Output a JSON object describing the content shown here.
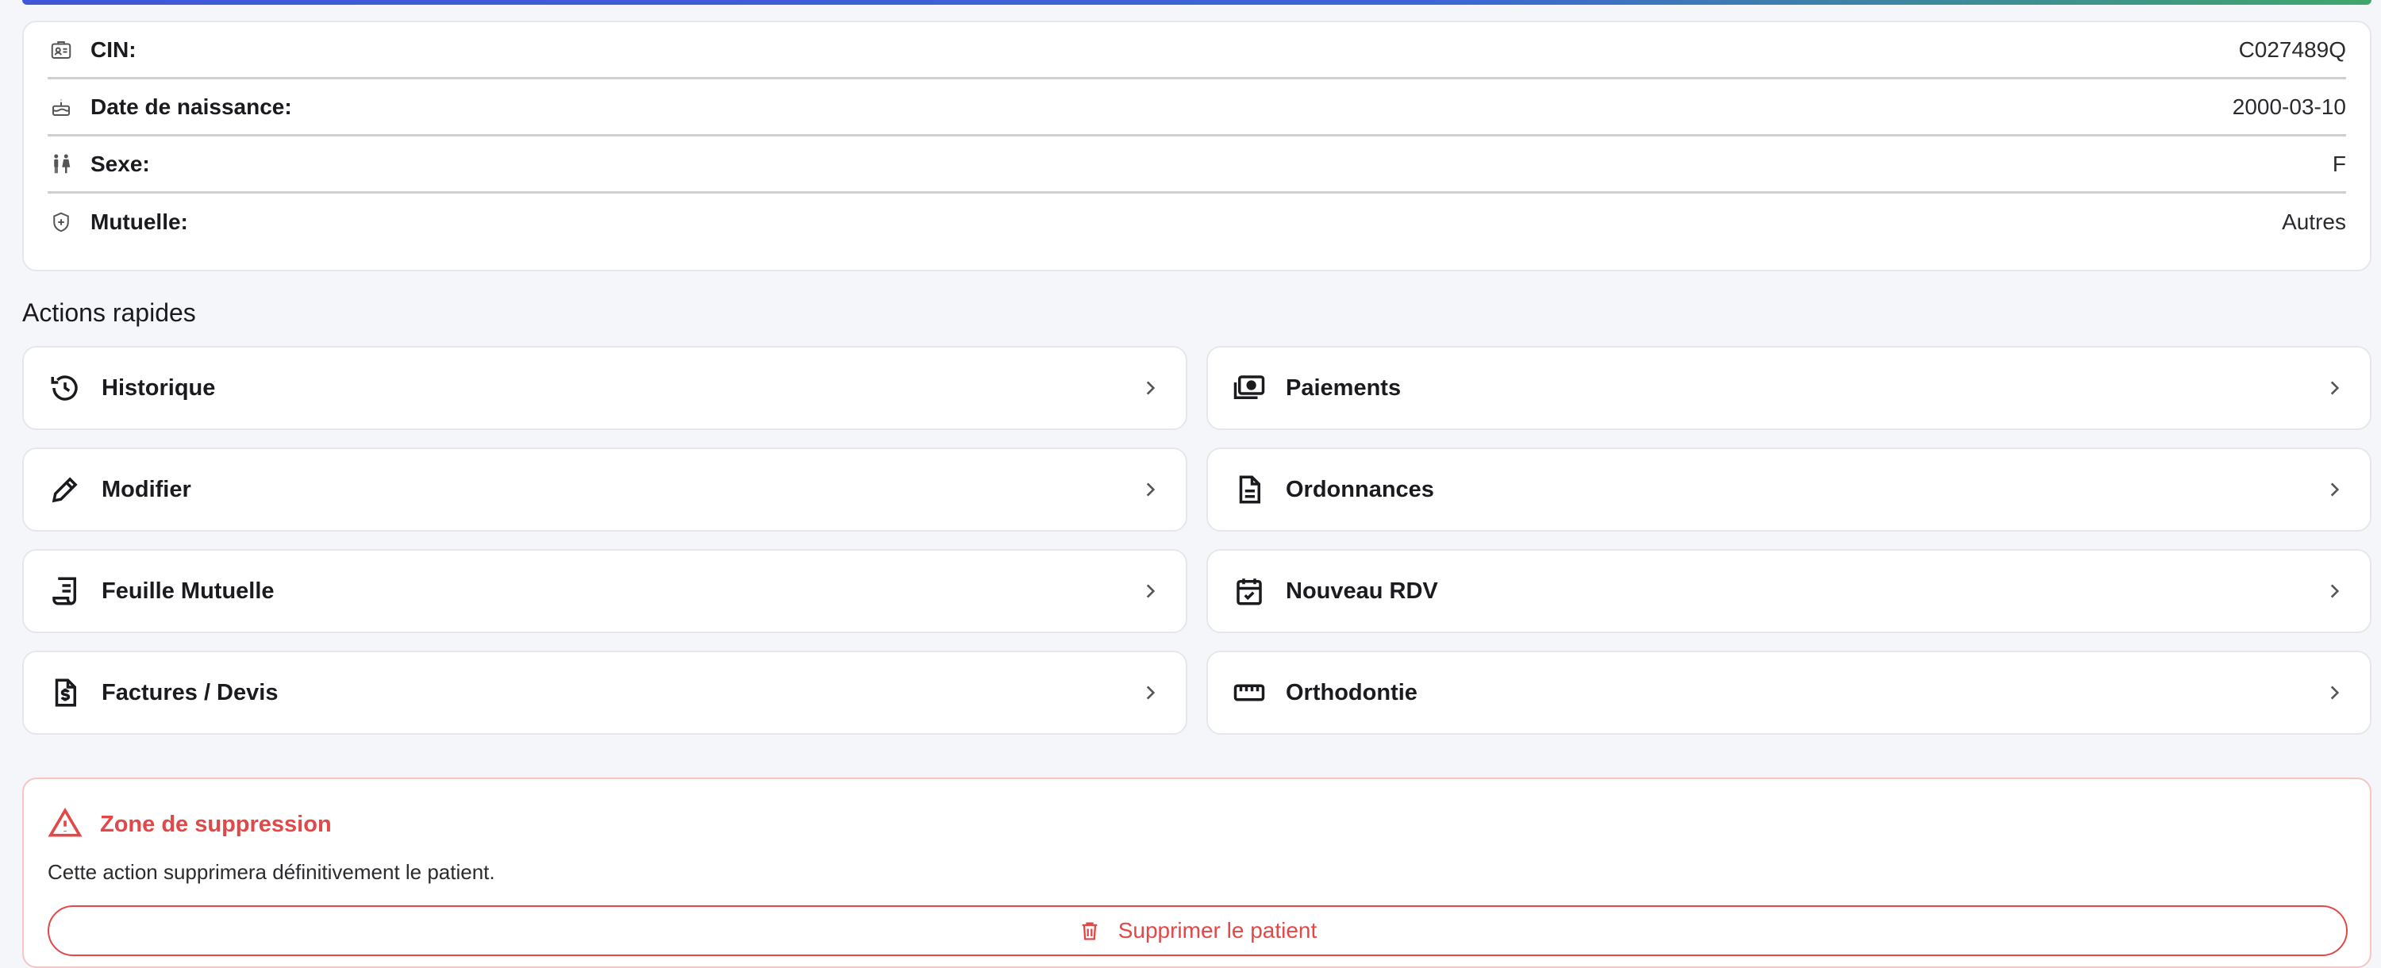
{
  "info": {
    "rows": [
      {
        "label": "CIN:",
        "value": "C027489Q",
        "icon": "id-card-icon"
      },
      {
        "label": "Date de naissance:",
        "value": "2000-03-10",
        "icon": "cake-icon"
      },
      {
        "label": "Sexe:",
        "value": "F",
        "icon": "gender-icon"
      },
      {
        "label": "Mutuelle:",
        "value": "Autres",
        "icon": "shield-plus-icon"
      }
    ]
  },
  "quick_actions": {
    "title": "Actions rapides",
    "items": [
      {
        "label": "Historique",
        "icon": "history-icon"
      },
      {
        "label": "Paiements",
        "icon": "payments-icon"
      },
      {
        "label": "Modifier",
        "icon": "pencil-icon"
      },
      {
        "label": "Ordonnances",
        "icon": "document-icon"
      },
      {
        "label": "Feuille Mutuelle",
        "icon": "receipt-icon"
      },
      {
        "label": "Nouveau RDV",
        "icon": "calendar-check-icon"
      },
      {
        "label": "Factures / Devis",
        "icon": "invoice-dollar-icon"
      },
      {
        "label": "Orthodontie",
        "icon": "ruler-icon"
      }
    ]
  },
  "danger_zone": {
    "title": "Zone de suppression",
    "text": "Cette action supprimera définitivement le patient.",
    "button_label": "Supprimer le patient",
    "color": "#e24848"
  }
}
